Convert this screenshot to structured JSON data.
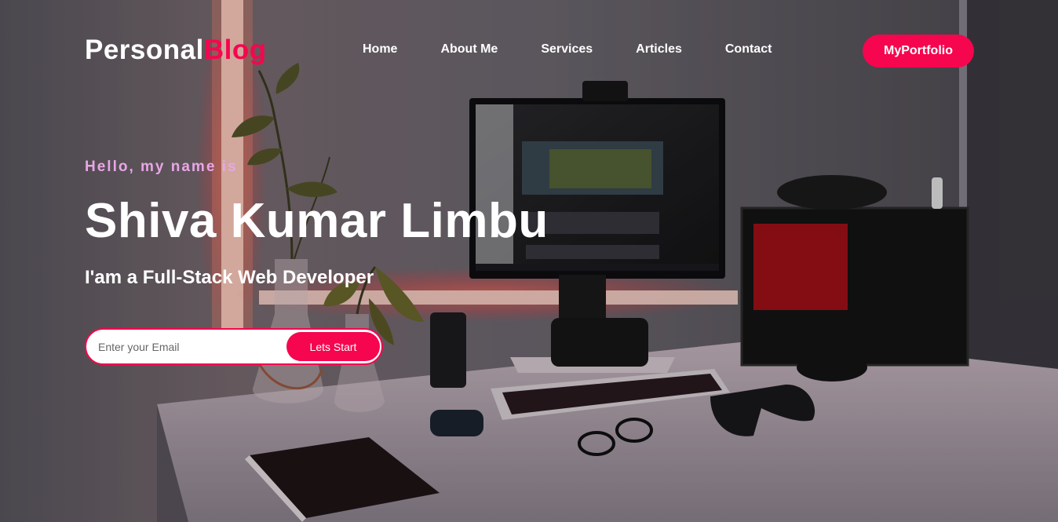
{
  "logo": {
    "part1": "Personal",
    "part2": "Blog"
  },
  "nav": {
    "items": [
      {
        "label": "Home"
      },
      {
        "label": "About Me"
      },
      {
        "label": "Services"
      },
      {
        "label": "Articles"
      },
      {
        "label": "Contact"
      }
    ],
    "portfolio_label": "MyPortfolio"
  },
  "hero": {
    "greeting": "Hello, my name is",
    "name": "Shiva Kumar Limbu",
    "role": "I'am a Full-Stack Web Developer",
    "email_placeholder": "Enter your Email",
    "email_value": "",
    "start_label": "Lets Start"
  },
  "colors": {
    "accent": "#f5064e",
    "greeting": "#e8a6e6",
    "text": "#ffffff"
  },
  "icons": {
    "background": "desk-setup-photo"
  }
}
